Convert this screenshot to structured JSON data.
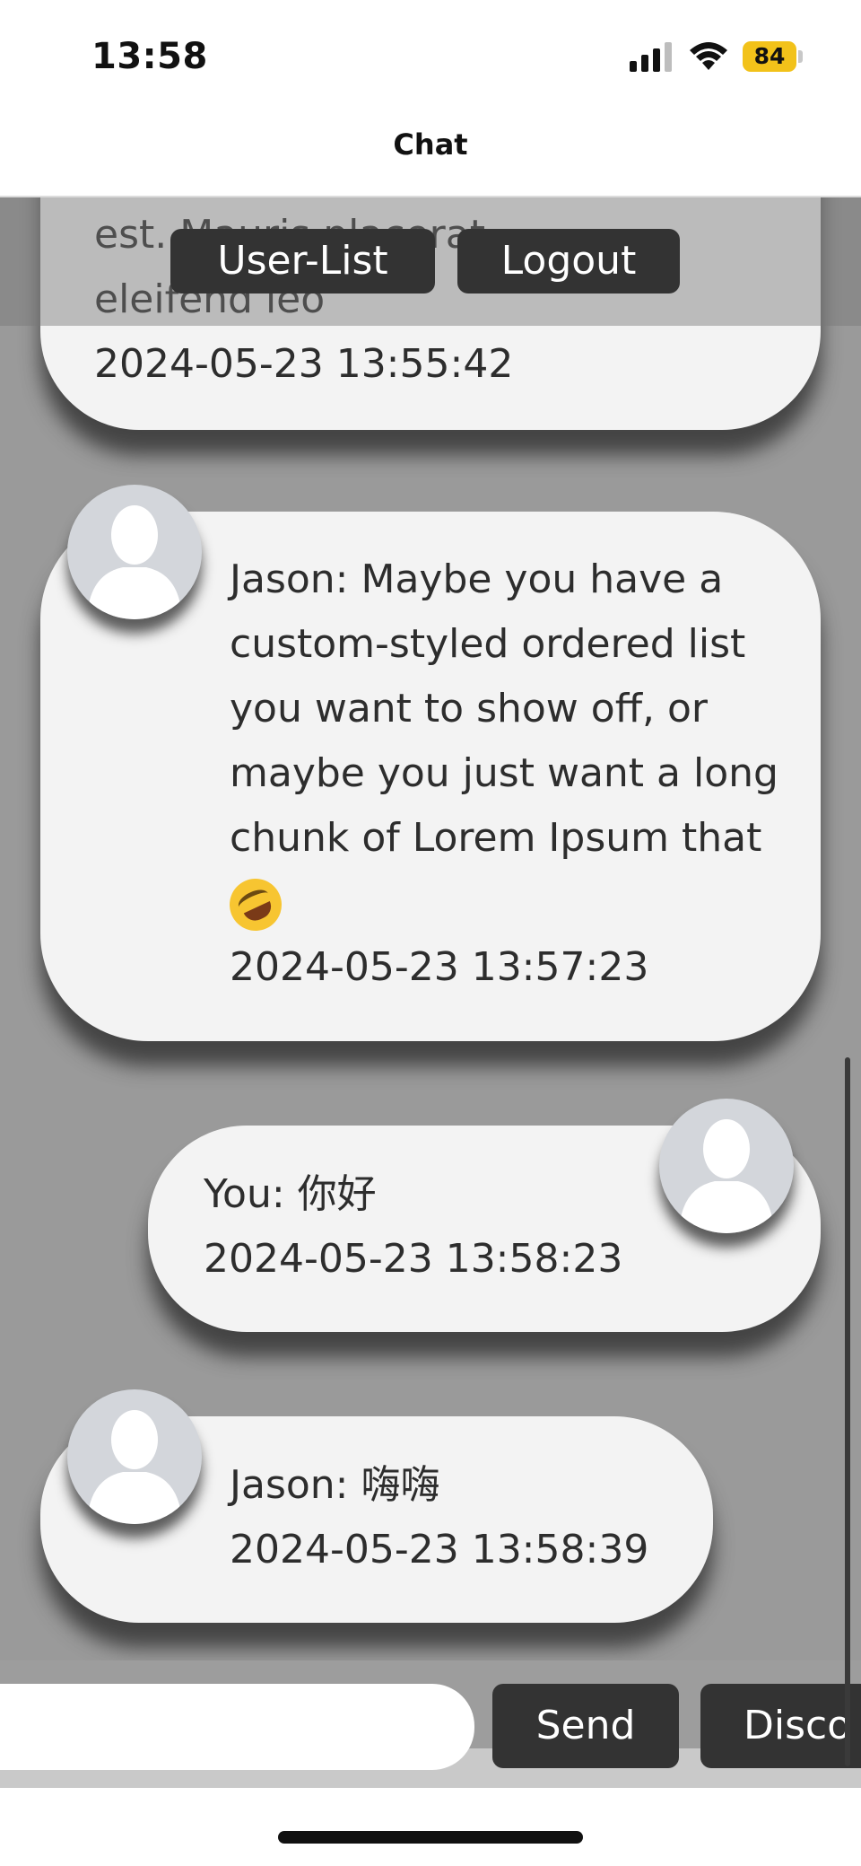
{
  "status_bar": {
    "time": "13:58",
    "battery": "84"
  },
  "nav": {
    "title": "Chat"
  },
  "top_buttons": {
    "user_list": "User-List",
    "logout": "Logout"
  },
  "messages": [
    {
      "lines": [
        "est. Mauris placerat",
        "eleifend leo"
      ],
      "timestamp": "2024-05-23 13:55:42"
    },
    {
      "lines": [
        "Jason: Maybe you have a",
        "custom-styled ordered list",
        "you want to show off, or",
        "maybe you just want a long",
        "chunk of Lorem Ipsum that"
      ],
      "emoji": "rolling-on-floor-laughing",
      "timestamp": "2024-05-23 13:57:23"
    },
    {
      "lines": [
        "You: 你好"
      ],
      "timestamp": "2024-05-23 13:58:23"
    },
    {
      "lines": [
        "Jason: 嗨嗨"
      ],
      "timestamp": "2024-05-23 13:58:39"
    }
  ],
  "input": {
    "value": "",
    "placeholder": ""
  },
  "bottom_buttons": {
    "send": "Send",
    "disconnect": "Disco"
  },
  "colors": {
    "background": "#9a9a9a",
    "bubble": "#f3f3f3",
    "button": "#333333",
    "battery": "#f2c21a"
  }
}
